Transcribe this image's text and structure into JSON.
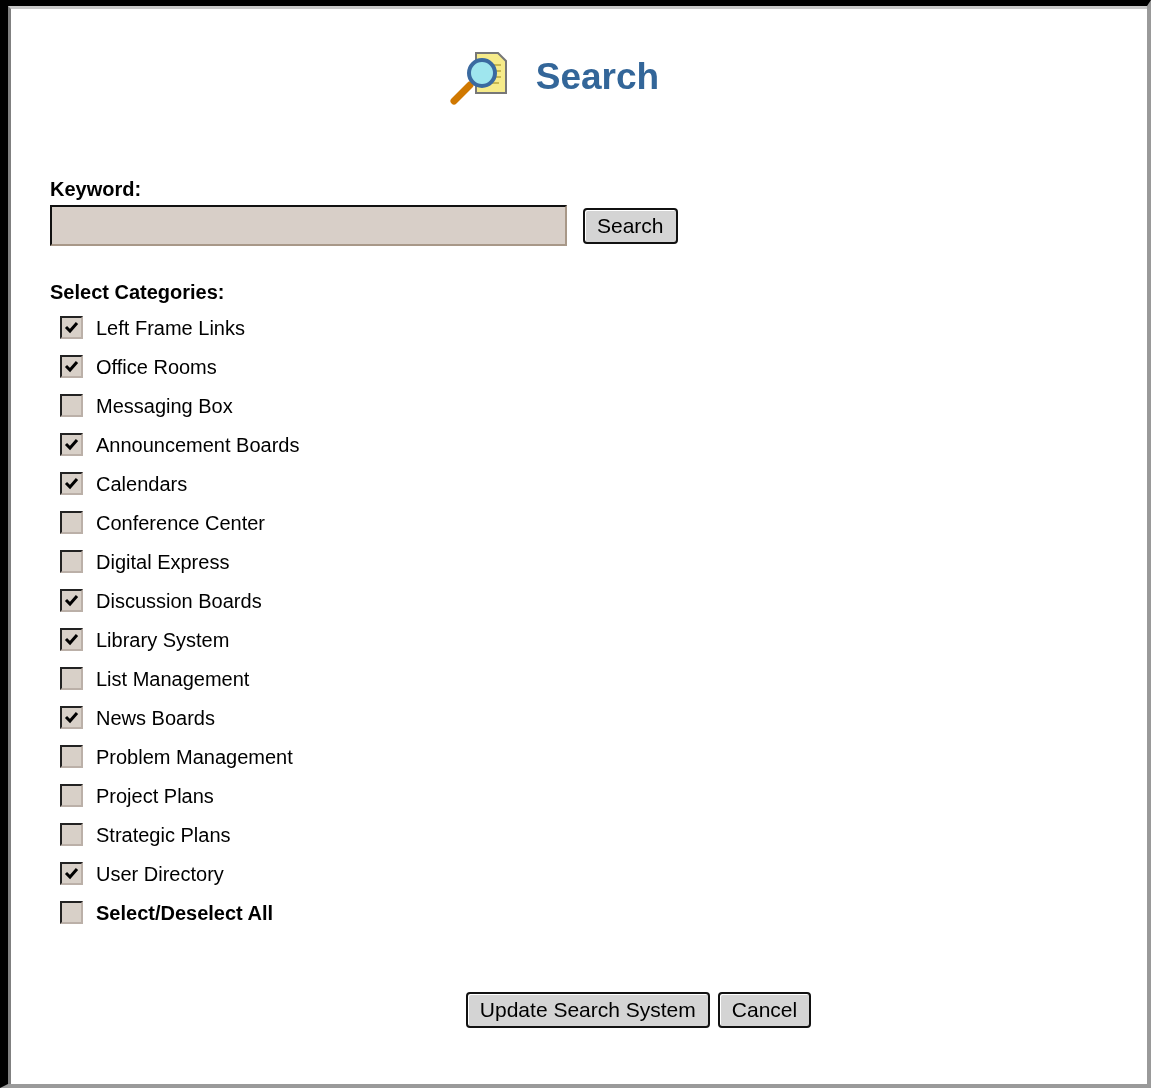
{
  "title": "Search",
  "keyword": {
    "label": "Keyword:",
    "button": "Search"
  },
  "categories_label": "Select Categories:",
  "categories": [
    {
      "label": "Left Frame Links",
      "checked": true,
      "kind": "item"
    },
    {
      "label": "Office Rooms",
      "checked": true,
      "kind": "item"
    },
    {
      "label": "Messaging Box",
      "checked": false,
      "kind": "item"
    },
    {
      "label": "Announcement Boards",
      "checked": true,
      "kind": "item"
    },
    {
      "label": "Calendars",
      "checked": true,
      "kind": "item"
    },
    {
      "label": "Conference Center",
      "checked": false,
      "kind": "item"
    },
    {
      "label": "Digital Express",
      "checked": false,
      "kind": "item"
    },
    {
      "label": "Discussion Boards",
      "checked": true,
      "kind": "item"
    },
    {
      "label": "Library System",
      "checked": true,
      "kind": "item"
    },
    {
      "label": "List Management",
      "checked": false,
      "kind": "item"
    },
    {
      "label": "News Boards",
      "checked": true,
      "kind": "item"
    },
    {
      "label": "Problem Management",
      "checked": false,
      "kind": "item"
    },
    {
      "label": "Project Plans",
      "checked": false,
      "kind": "item"
    },
    {
      "label": "Strategic Plans",
      "checked": false,
      "kind": "item"
    },
    {
      "label": "User Directory",
      "checked": true,
      "kind": "item"
    },
    {
      "label": "Select/Deselect All",
      "checked": false,
      "kind": "select_all"
    }
  ],
  "buttons": [
    "Update Search System",
    "Cancel"
  ]
}
